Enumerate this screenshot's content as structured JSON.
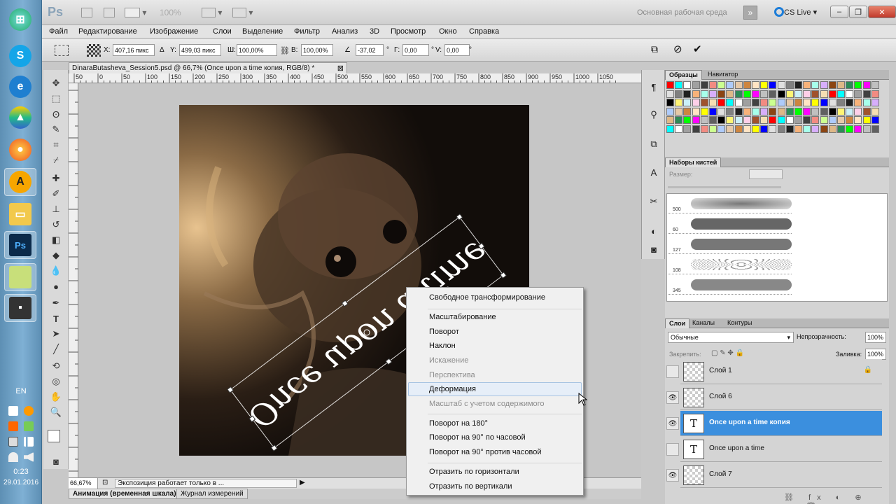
{
  "taskbar": {
    "lang": "EN",
    "time": "0:23",
    "date": "29.01.2016"
  },
  "appbar": {
    "logo": "Ps",
    "zoom": "100%",
    "workspace": "Основная рабочая среда",
    "cslive": "CS Live"
  },
  "menu": [
    "Файл",
    "Редактирование",
    "Изображение",
    "Слои",
    "Выделение",
    "Фильтр",
    "Анализ",
    "3D",
    "Просмотр",
    "Окно",
    "Справка"
  ],
  "options": {
    "x_label": "X:",
    "x_value": "407,16 пикс",
    "y_label": "Y:",
    "y_value": "499,03 пикс",
    "w_label": "Ш:",
    "w_value": "100,00%",
    "h_label": "В:",
    "h_value": "100,00%",
    "angle_value": "-37,02",
    "h_skew_label": "Г:",
    "h_skew_value": "0,00",
    "v_skew_label": "V:",
    "v_skew_value": "0,00",
    "degree": "°"
  },
  "document": {
    "tab_title": "DinaraButasheva_Session5.psd @ 66,7% (Once upon a time копия, RGB/8) *",
    "canvas_text": "Once upon a time"
  },
  "ruler": [
    "50",
    "0",
    "50",
    "100",
    "150",
    "200",
    "250",
    "300",
    "350",
    "400",
    "450",
    "500",
    "550",
    "600",
    "650",
    "700",
    "750",
    "800",
    "850",
    "900",
    "950",
    "1000",
    "1050"
  ],
  "status": {
    "zoom": "66,67%",
    "text": "Экспозиция работает только в ..."
  },
  "bottom_tabs": [
    "Анимация (временная шкала)",
    "Журнал измерений"
  ],
  "panels": {
    "swatches_tab": "Образцы",
    "navigator_tab": "Навигатор",
    "brush_tab": "Наборы кистей",
    "size_label": "Размер:",
    "brush_sizes": [
      "500",
      "60",
      "127",
      "108",
      "345"
    ],
    "layers_tab": "Слои",
    "channels_tab": "Каналы",
    "paths_tab": "Контуры",
    "blend_mode": "Обычные",
    "opacity_label": "Непрозрачность:",
    "opacity_value": "100%",
    "lock_label": "Закрепить:",
    "fill_label": "Заливка:",
    "fill_value": "100%"
  },
  "layers": [
    {
      "name": "Слой 1",
      "type": "raster",
      "visible": false,
      "selected": false
    },
    {
      "name": "Слой 6",
      "type": "raster",
      "visible": true,
      "selected": false
    },
    {
      "name": "Once upon a time копия",
      "type": "text",
      "visible": true,
      "selected": true
    },
    {
      "name": "Once upon a time",
      "type": "text",
      "visible": false,
      "selected": false
    },
    {
      "name": "Слой 7",
      "type": "raster",
      "visible": true,
      "selected": false
    }
  ],
  "layer_thumb_text": "T",
  "context_menu": {
    "free": "Свободное трансформирование",
    "scale": "Масштабирование",
    "rotate": "Поворот",
    "skew": "Наклон",
    "distort": "Искажение",
    "perspective": "Перспектива",
    "warp": "Деформация",
    "content_aware": "Масштаб с учетом содержимого",
    "rot180": "Поворот на 180°",
    "rot90cw": "Поворот на 90° по часовой",
    "rot90ccw": "Поворот на 90° против часовой",
    "flip_h": "Отразить по горизонтали",
    "flip_v": "Отразить по вертикали"
  },
  "colors": {
    "accent": "#3b8fde",
    "menu_bg": "#f0f0f0",
    "canvas_bg": "#c6c6c6"
  }
}
